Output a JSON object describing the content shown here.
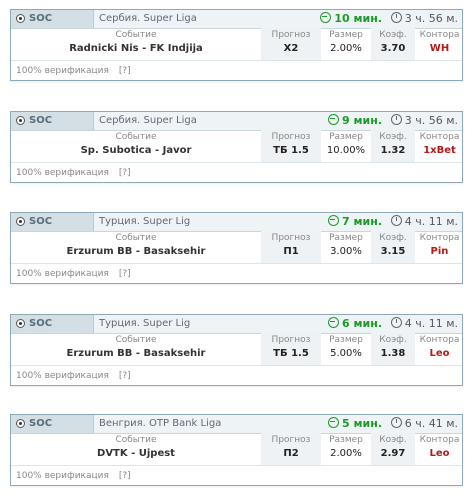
{
  "tips": [
    {
      "sport": "SOC",
      "league": "Сербия. Super Liga",
      "timer": "10 мин.",
      "start": "3 ч. 56 м.",
      "event": "Radnicki Nis - FK Indjija",
      "prediction": "X2",
      "size": "2.00%",
      "coef": "3.70",
      "bookmaker": "WH",
      "verify": "100% верификация",
      "help": "[?]"
    },
    {
      "sport": "SOC",
      "league": "Сербия. Super Liga",
      "timer": "9 мин.",
      "start": "3 ч. 56 м.",
      "event": "Sp. Subotica - Javor",
      "prediction": "ТБ 1.5",
      "size": "10.00%",
      "coef": "1.32",
      "bookmaker": "1xBet",
      "verify": "100% верификация",
      "help": "[?]"
    },
    {
      "sport": "SOC",
      "league": "Турция. Super Lig",
      "timer": "7 мин.",
      "start": "4 ч. 11 м.",
      "event": "Erzurum BB - Basaksehir",
      "prediction": "П1",
      "size": "3.00%",
      "coef": "3.15",
      "bookmaker": "Pin",
      "verify": "100% верификация",
      "help": "[?]"
    },
    {
      "sport": "SOC",
      "league": "Турция. Super Lig",
      "timer": "6 мин.",
      "start": "4 ч. 11 м.",
      "event": "Erzurum BB - Basaksehir",
      "prediction": "ТБ 1.5",
      "size": "5.00%",
      "coef": "1.38",
      "bookmaker": "Leo",
      "verify": "100% верификация",
      "help": "[?]"
    },
    {
      "sport": "SOC",
      "league": "Венгрия. OTP Bank Liga",
      "timer": "5 мин.",
      "start": "6 ч. 41 м.",
      "event": "DVTK - Ujpest",
      "prediction": "П2",
      "size": "2.00%",
      "coef": "2.97",
      "bookmaker": "Leo",
      "verify": "100% верификация",
      "help": "[?]"
    }
  ],
  "labels": {
    "event": "Событие",
    "prediction": "Прогноз",
    "size": "Размер",
    "coef": "Коэф.",
    "bookmaker": "Контора"
  },
  "colors": {
    "timer": "#1f9a2a",
    "bookmaker": "#b41b1b",
    "border": "#8fa9b6"
  },
  "icons": {
    "sport": "soccer-ball-icon",
    "timer": "arrow-circle-icon",
    "start": "clock-icon"
  }
}
